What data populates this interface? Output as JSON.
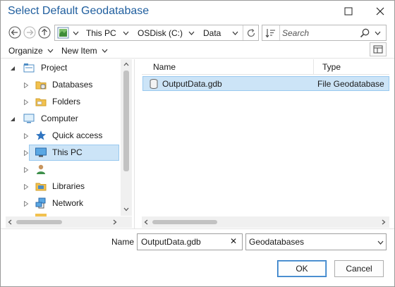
{
  "window": {
    "title": "Select Default Geodatabase",
    "maximize_glyph": "□",
    "close_glyph": "✕"
  },
  "address": {
    "crumbs": [
      "This PC",
      "OSDisk (C:)",
      "Data"
    ]
  },
  "search": {
    "placeholder": "Search"
  },
  "toolbar": {
    "organize_label": "Organize",
    "new_item_label": "New Item"
  },
  "tree": {
    "items": [
      {
        "label": "Project",
        "icon": "project-icon",
        "expanded": true
      },
      {
        "label": "Databases",
        "icon": "database-folder-icon"
      },
      {
        "label": "Folders",
        "icon": "folder-icon"
      },
      {
        "label": "Computer",
        "icon": "computer-icon",
        "expanded": true
      },
      {
        "label": "Quick access",
        "icon": "star-icon"
      },
      {
        "label": "This PC",
        "icon": "monitor-icon",
        "selected": true
      },
      {
        "label": "",
        "icon": "user-icon"
      },
      {
        "label": "Libraries",
        "icon": "libraries-icon"
      },
      {
        "label": "Network",
        "icon": "network-icon"
      }
    ]
  },
  "list": {
    "columns": [
      "Name",
      "Type"
    ],
    "rows": [
      {
        "name": "OutputData.gdb",
        "type": "File Geodatabase",
        "icon": "geodatabase-icon",
        "selected": true
      }
    ]
  },
  "footer": {
    "name_label": "Name",
    "name_value": "OutputData.gdb",
    "clear_glyph": "✕",
    "filter_value": "Geodatabases",
    "ok_label": "OK",
    "cancel_label": "Cancel"
  },
  "colors": {
    "title": "#1f5e9e",
    "selection_bg": "#cce4f7",
    "selection_border": "#99c9ef",
    "ok_border": "#2b78c4"
  }
}
